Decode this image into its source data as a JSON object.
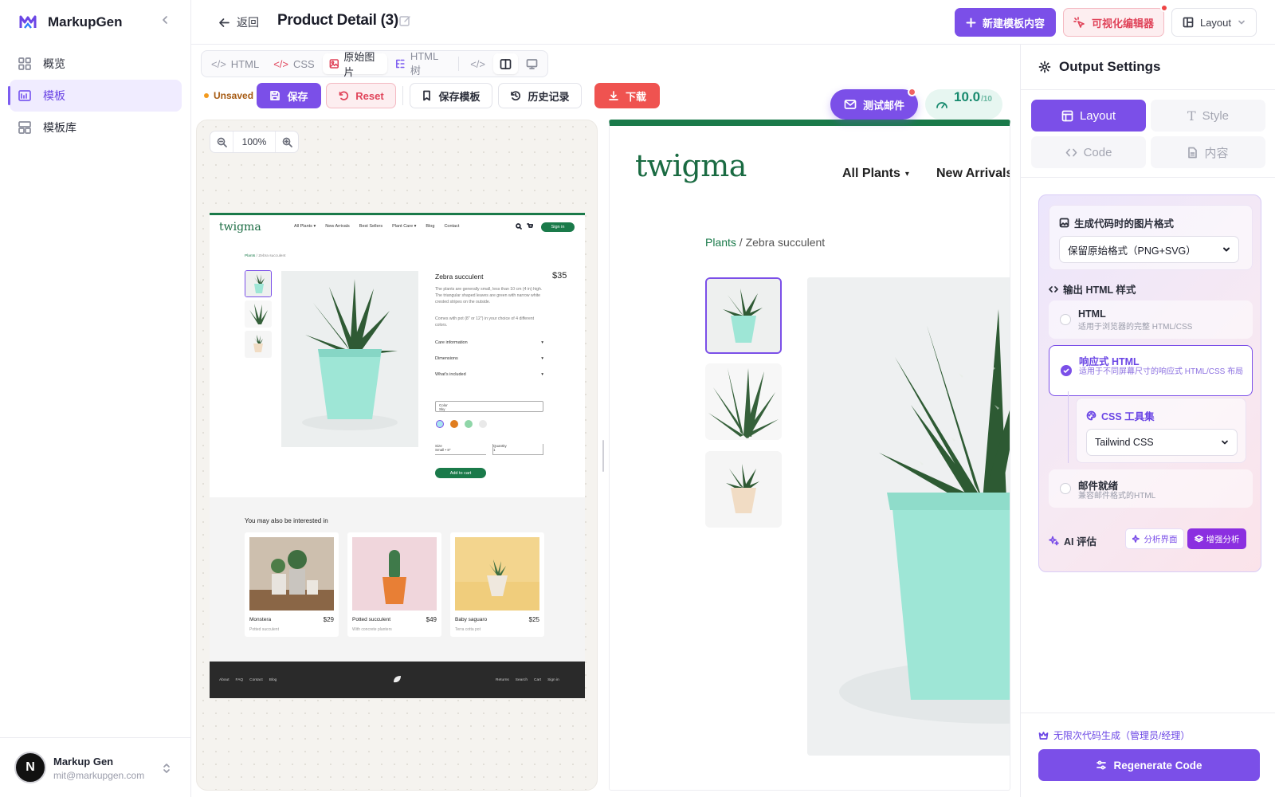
{
  "app": {
    "brand": "MarkupGen"
  },
  "sidebar": {
    "items": [
      {
        "label": "概览",
        "active": false
      },
      {
        "label": "模板",
        "active": true
      },
      {
        "label": "模板库",
        "active": false
      }
    ],
    "user": {
      "initial": "N",
      "name": "Markup Gen",
      "email": "mit@markupgen.com"
    }
  },
  "topbar": {
    "back_label": "返回",
    "title": "Product Detail (3)",
    "new_template": "新建模板内容",
    "visual_editor": "可视化编辑器",
    "layout": "Layout"
  },
  "toolbar": {
    "tabs": [
      "HTML",
      "CSS",
      "原始图片",
      "HTML 树"
    ],
    "active_tab": "原始图片",
    "unsaved": "Unsaved",
    "save": "保存",
    "reset": "Reset",
    "save_template": "保存模板",
    "history": "历史记录",
    "download": "下载"
  },
  "floating": {
    "test_email": "测试邮件",
    "score": "10.0",
    "score_max": "/10"
  },
  "canvas": {
    "zoom": "100%"
  },
  "mini": {
    "logo": "twigma",
    "nav": [
      "All Plants ▾",
      "New Arrivals",
      "Best Sellers",
      "Plant Care ▾",
      "Blog",
      "Contact"
    ],
    "sign_in": "Sign in",
    "breadcrumb_link": "Plants",
    "breadcrumb_rest": " / Zebra succulent",
    "product_name": "Zebra succulent",
    "price": "$35",
    "desc1": "The plants are generally small, less than 10 cm (4 in) high. The triangular shaped leaves are green with narrow white crested stripes on the outside.",
    "desc2": "Comes with pot (8\" or 12\") in your choice of 4 different colors.",
    "accordions": [
      "Care information",
      "Dimensions",
      "What's included"
    ],
    "color_label": "Color",
    "color_value": "Sky",
    "size_label": "Size",
    "size_value": "Small • 8\"",
    "qty_label": "Quantity",
    "qty_value": "1",
    "add_to_cart": "Add to cart",
    "related_title": "You may also be interested in",
    "related": [
      {
        "name": "Monstera",
        "price": "$29",
        "sub": "Potted succulent"
      },
      {
        "name": "Potted succulent",
        "price": "$49",
        "sub": "With concrete planters"
      },
      {
        "name": "Baby saguaro",
        "price": "$25",
        "sub": "Terra cotta pot"
      }
    ],
    "footer_left": [
      "About",
      "FAQ",
      "Contact",
      "Blog"
    ],
    "footer_right": [
      "Returns",
      "Search",
      "Cart",
      "Sign in"
    ]
  },
  "preview": {
    "logo": "twigma",
    "nav1": "All Plants",
    "nav2": "New Arrivals",
    "breadcrumb_link": "Plants",
    "breadcrumb_rest": " / Zebra succulent"
  },
  "panel": {
    "title": "Output Settings",
    "tabs": [
      "Layout",
      "Style",
      "Code",
      "内容"
    ],
    "img_format_label": "生成代码时的图片格式",
    "img_format_value": "保留原始格式（PNG+SVG）",
    "html_style_label": "输出 HTML 样式",
    "options": [
      {
        "title": "HTML",
        "desc": "适用于浏览器的完整 HTML/CSS"
      },
      {
        "title": "响应式 HTML",
        "desc": "适用于不同屏幕尺寸的响应式 HTML/CSS 布局"
      },
      {
        "title": "邮件就绪",
        "desc": "兼容邮件格式的HTML"
      }
    ],
    "css_toolkit_label": "CSS 工具集",
    "css_toolkit_value": "Tailwind CSS",
    "ai_label": "AI 评估",
    "ai_btn1": "分析界面",
    "ai_btn2": "增强分析",
    "unlimited": "无限次代码生成（管理员/经理）",
    "regenerate": "Regenerate Code"
  },
  "colors": {
    "accent": "#7b4fe8",
    "danger": "#ef5350",
    "plant_green": "#1a7a4a",
    "pot_mint": "#9ee6d6"
  }
}
